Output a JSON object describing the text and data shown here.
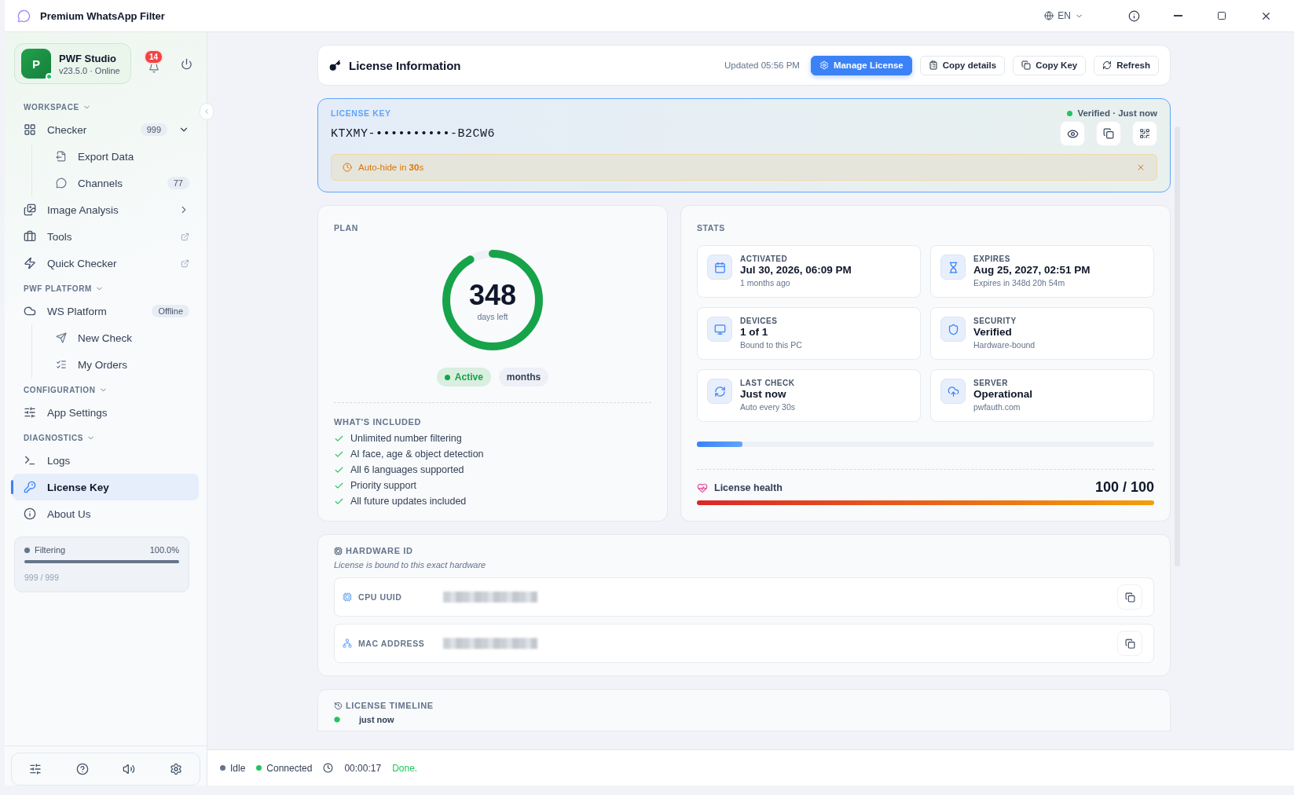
{
  "window": {
    "title": "Premium WhatsApp Filter",
    "language": "EN"
  },
  "sidebar": {
    "profile": {
      "initial": "P",
      "name": "PWF Studio",
      "subtitle": "v23.5.0 · Online",
      "online": true
    },
    "notifications": "14",
    "sections": [
      {
        "title": "WORKSPACE",
        "expanded": true,
        "items": [
          {
            "label": "Checker",
            "badge": "999",
            "expanded": true,
            "selected": false,
            "children": [
              {
                "label": "Export Data",
                "selected": false
              },
              {
                "label": "Channels",
                "badge": "77",
                "selected": false
              }
            ]
          },
          {
            "label": "Image Analysis",
            "expanded": false,
            "selected": false
          },
          {
            "label": "Tools",
            "external": true,
            "selected": false
          },
          {
            "label": "Quick Checker",
            "external": true,
            "selected": false
          }
        ]
      },
      {
        "title": "PWF PLATFORM",
        "expanded": true,
        "items": [
          {
            "label": "WS Platform",
            "badge": "Offline",
            "selected": false,
            "children": [
              {
                "label": "New Check",
                "selected": false
              },
              {
                "label": "My Orders",
                "selected": false
              }
            ]
          }
        ]
      },
      {
        "title": "CONFIGURATION",
        "expanded": true,
        "items": [
          {
            "label": "App Settings",
            "selected": false
          }
        ]
      },
      {
        "title": "DIAGNOSTICS",
        "expanded": true,
        "items": [
          {
            "label": "Logs",
            "selected": false
          },
          {
            "label": "License Key",
            "selected": true
          },
          {
            "label": "About Us",
            "selected": false
          }
        ]
      }
    ],
    "progress": {
      "label": "Filtering",
      "percent": "100.0%",
      "count": "999 / 999",
      "level": 1
    }
  },
  "header": {
    "title": "License Information",
    "updated": "Updated 05:56 PM",
    "buttons": [
      {
        "label": "Manage License",
        "primary": true
      },
      {
        "label": "Copy details",
        "primary": false
      },
      {
        "label": "Copy Key",
        "primary": false
      },
      {
        "label": "Refresh",
        "primary": false
      }
    ]
  },
  "license_key": {
    "label": "LICENSE KEY",
    "key": "KTXMY-••••••••••-B2CW6",
    "status": "Verified · Just now",
    "notice": "Auto-hide in **30**s"
  },
  "plan": {
    "title": "PLAN",
    "days": "348",
    "days_label": "days left",
    "level": 0.92,
    "status": "Active",
    "term": "months",
    "included_title": "WHAT'S INCLUDED",
    "features": [
      "Unlimited number filtering",
      "AI face, age & object detection",
      "All 6 languages supported",
      "Priority support",
      "All future updates included"
    ]
  },
  "stats": {
    "title": "STATS",
    "tiles": [
      {
        "label": "ACTIVATED",
        "value": "Jul 30, 2026, 06:09 PM",
        "note": "1 months ago"
      },
      {
        "label": "EXPIRES",
        "value": "Aug 25, 2027, 02:51 PM",
        "note": "Expires in 348d 20h 54m"
      },
      {
        "label": "DEVICES",
        "value": "1 of 1",
        "note": "Bound to this PC"
      },
      {
        "label": "SECURITY",
        "value": "Verified",
        "note": "Hardware-bound"
      },
      {
        "label": "LAST CHECK",
        "value": "Just now",
        "note": "Auto every 30s"
      },
      {
        "label": "SERVER",
        "value": "Operational",
        "note": "pwfauth.com"
      }
    ],
    "sync": {
      "level": 0.1
    },
    "health": {
      "label": "License health",
      "score": "100 / 100",
      "level": 1
    }
  },
  "hardware": {
    "title": "HARDWARE ID",
    "subtitle": "License is bound to this exact hardware",
    "rows": [
      {
        "label": "CPU UUID"
      },
      {
        "label": "MAC ADDRESS"
      }
    ]
  },
  "timeline": {
    "title": "LICENSE TIMELINE",
    "entries": [
      {
        "time": "just now"
      }
    ]
  },
  "status_bar": [
    {
      "text": "Idle",
      "kind": "dot",
      "color": "#64748b"
    },
    {
      "text": "Connected",
      "kind": "dot",
      "color": "#22c55e"
    },
    {
      "text": "00:00:17",
      "kind": "timer"
    },
    {
      "text": "Done.",
      "kind": "message"
    }
  ]
}
